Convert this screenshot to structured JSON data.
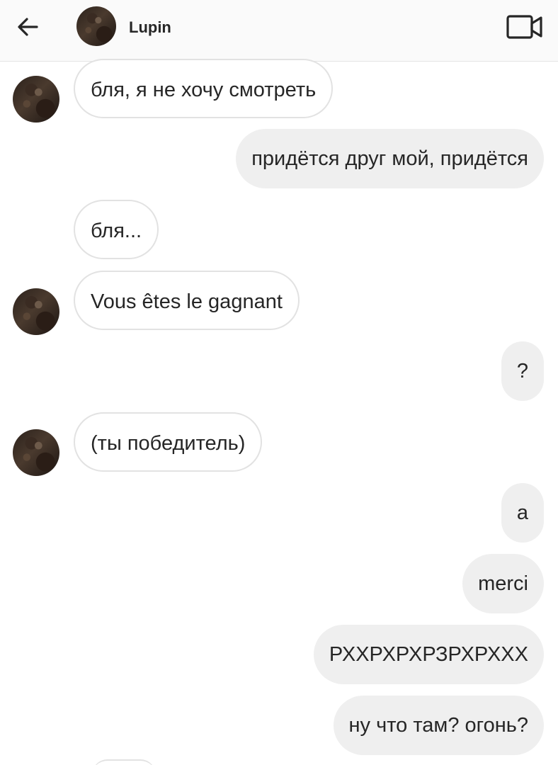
{
  "header": {
    "contact_name": "Lupin",
    "back_icon": "arrow-left-icon",
    "video_icon": "video-camera-icon"
  },
  "messages": [
    {
      "direction": "incoming",
      "text": "бля, я не хочу смотреть",
      "show_avatar": true
    },
    {
      "direction": "outgoing",
      "text": "придётся друг мой, придётся"
    },
    {
      "direction": "incoming",
      "text": "бля...",
      "show_avatar": false
    },
    {
      "direction": "incoming",
      "text": "Vous êtes le gagnant",
      "show_avatar": true
    },
    {
      "direction": "outgoing",
      "text": "?"
    },
    {
      "direction": "incoming",
      "text": "(ты победитель)",
      "show_avatar": true
    },
    {
      "direction": "outgoing",
      "text": "а"
    },
    {
      "direction": "outgoing",
      "text": "merci"
    },
    {
      "direction": "outgoing",
      "text": "РХХРХРХРЗРХРХХХ"
    },
    {
      "direction": "outgoing",
      "text": "ну что там? огонь?"
    }
  ],
  "colors": {
    "header_bg": "#fafafa",
    "outgoing_bubble": "#efefef",
    "incoming_border": "#e2e2e2",
    "text": "#262626"
  }
}
